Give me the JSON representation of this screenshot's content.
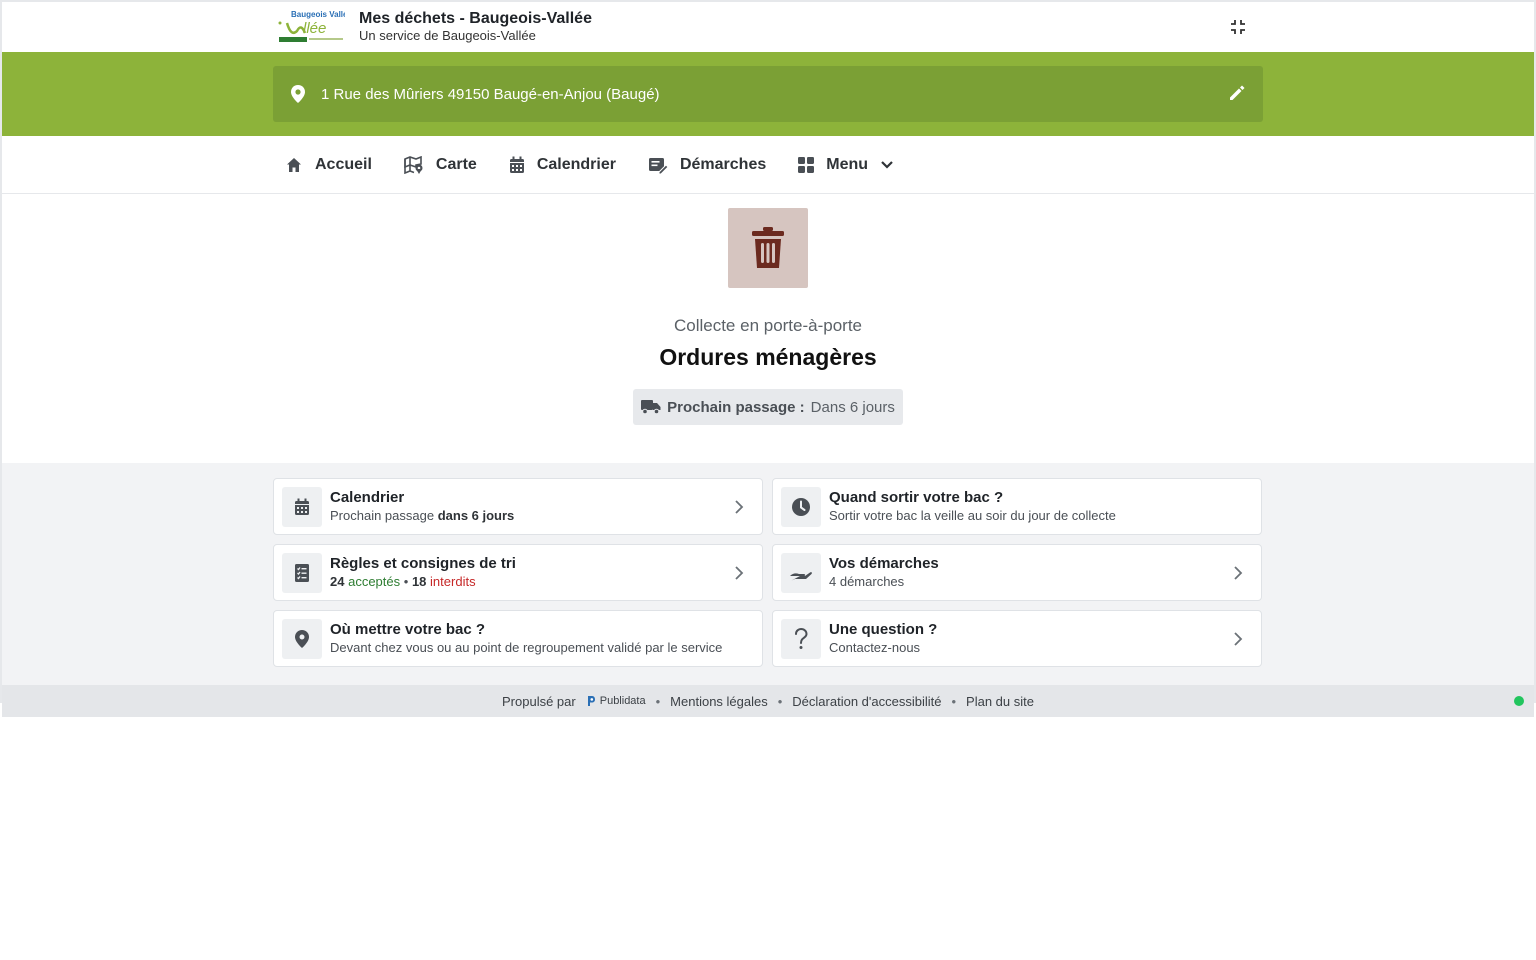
{
  "header": {
    "logo_text": "Baugeois Vallée",
    "title": "Mes déchets - Baugeois-Vallée",
    "subtitle": "Un service de Baugeois-Vallée"
  },
  "address": {
    "text": "1 Rue des Mûriers 49150 Baugé-en-Anjou (Baugé)"
  },
  "nav": {
    "items": [
      {
        "label": "Accueil",
        "icon": "home-icon"
      },
      {
        "label": "Carte",
        "icon": "map-icon"
      },
      {
        "label": "Calendrier",
        "icon": "calendar-icon"
      },
      {
        "label": "Démarches",
        "icon": "form-icon"
      },
      {
        "label": "Menu",
        "icon": "grid-icon"
      }
    ]
  },
  "hero": {
    "icon": "trash-icon",
    "icon_bg": "#d6c5c0",
    "icon_color": "#6b2a1f",
    "subtitle": "Collecte en porte-à-porte",
    "title": "Ordures ménagères",
    "next_label": "Prochain passage :",
    "next_value": "Dans 6 jours"
  },
  "cards": {
    "calendar": {
      "title": "Calendrier",
      "desc_prefix": "Prochain passage",
      "desc_bold": "dans 6 jours",
      "icon": "calendar-icon"
    },
    "when": {
      "title": "Quand sortir votre bac ?",
      "desc": "Sortir votre bac la veille au soir du jour de collecte",
      "icon": "clock-icon"
    },
    "rules": {
      "title": "Règles et consignes de tri",
      "accepted_count": "24",
      "accepted_label": "acceptés",
      "separator": "•",
      "forbidden_count": "18",
      "forbidden_label": "interdits",
      "icon": "checklist-icon"
    },
    "procedures": {
      "title": "Vos démarches",
      "desc": "4 démarches",
      "icon": "hand-icon"
    },
    "where": {
      "title": "Où mettre votre bac ?",
      "desc": "Devant chez vous ou au point de regroupement validé par le service",
      "icon": "location-icon"
    },
    "question": {
      "title": "Une question ?",
      "desc": "Contactez-nous",
      "icon": "question-icon"
    }
  },
  "footer": {
    "powered_by": "Propulsé par",
    "brand": "Publidata",
    "legal": "Mentions légales",
    "accessibility": "Déclaration d'accessibilité",
    "sitemap": "Plan du site",
    "separator": "•"
  },
  "colors": {
    "brand_green": "#8db33a",
    "address_bar": "#7ba035",
    "status_dot": "#22c55e"
  }
}
